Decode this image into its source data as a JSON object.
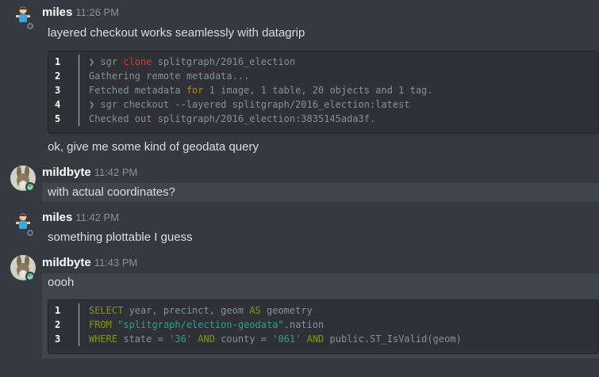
{
  "messages": [
    {
      "author": "miles",
      "time": "11:26 PM",
      "lines": [
        "layered checkout works seamlessly with datagrip"
      ],
      "code": [
        [
          "1",
          "❯ sgr ",
          "clone",
          " splitgraph/2016_election"
        ],
        [
          "2",
          "Gathering remote metadata..."
        ],
        [
          "3",
          "Fetched metadata ",
          "for",
          " 1 image, 1 table, 20 objects and 1 tag."
        ],
        [
          "4",
          "❯ sgr checkout --layered splitgraph/2016_election:latest"
        ],
        [
          "5",
          "Checked out splitgraph/2016_election:3835145ada3f."
        ]
      ],
      "after": "ok, give me some kind of geodata query"
    },
    {
      "author": "mildbyte",
      "time": "11:42 PM",
      "lines": [
        "with actual coordinates?"
      ]
    },
    {
      "author": "miles",
      "time": "11:42 PM",
      "lines": [
        "something plottable I guess"
      ]
    },
    {
      "author": "mildbyte",
      "time": "11:43 PM",
      "lines": [
        "oooh"
      ],
      "sql": {
        "l1": {
          "n": "1",
          "a": "SELECT",
          "b": " year, precinct, geom ",
          "c": "AS",
          "d": " geometry"
        },
        "l2": {
          "n": "2",
          "a": "FROM",
          "b": " ",
          "c": "\"splitgraph/election-geodata\"",
          "d": ".nation"
        },
        "l3": {
          "n": "3",
          "a": "WHERE",
          "b": " state = ",
          "c": "'36'",
          "d": " ",
          "e": "AND",
          "f": " county = ",
          "g": "'061'",
          "h": " ",
          "i": "AND",
          "j": " public.ST_IsValid(geom)"
        }
      }
    }
  ],
  "colors": {
    "background": "#36393f",
    "online": "#43b581",
    "code_bg": "#2f3136"
  }
}
